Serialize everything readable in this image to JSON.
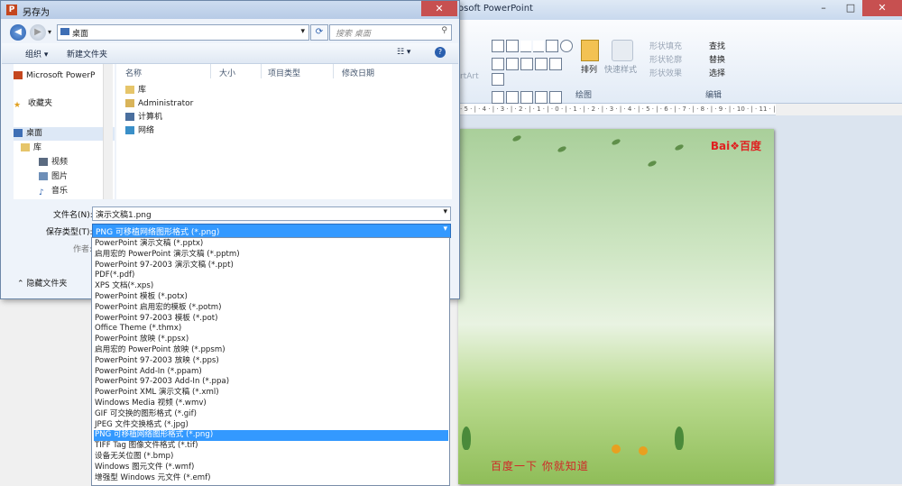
{
  "powerpoint": {
    "title": "osoft PowerPoint",
    "window_controls": [
      "–",
      "□",
      "✕"
    ],
    "ribbon": {
      "arrange_label": "排列",
      "quick_styles_label": "快速样式",
      "shape_fill": "形状填充",
      "shape_outline": "形状轮廓",
      "shape_effects": "形状效果",
      "find": "查找",
      "replace": "替换",
      "select": "选择",
      "group_drawing": "绘图",
      "group_editing": "编辑",
      "art_label": "rtArt"
    },
    "ruler_text": "· 5 · | · 4 · | · 3 · | · 2 · | · 1 · | · 0 · | · 1 · | · 2 · | · 3 · | · 4 · | · 5 · | · 6 · | · 7 · | · 8 · | · 9 · | · 10 · | · 11 · | · 12 ·",
    "slide": {
      "logo": "Bai❖百度",
      "caption": "百度一下  你就知道"
    }
  },
  "dialog": {
    "title": "另存为",
    "app_icon": "P",
    "address": "桌面",
    "search_placeholder": "搜索 桌面",
    "toolbar": {
      "organize": "组织 ▾",
      "new_folder": "新建文件夹"
    },
    "nav": [
      {
        "label": "Microsoft PowerP",
        "icon": "powerpoint-icon"
      },
      {
        "label": "收藏夹",
        "icon": "star-icon"
      },
      {
        "label": "桌面",
        "icon": "desktop-icon"
      },
      {
        "label": "库",
        "icon": "library-icon"
      },
      {
        "label": "视频",
        "icon": "video-icon"
      },
      {
        "label": "图片",
        "icon": "picture-icon"
      },
      {
        "label": "音乐",
        "icon": "music-icon"
      }
    ],
    "columns": [
      "名称",
      "大小",
      "项目类型",
      "修改日期"
    ],
    "files": [
      {
        "name": "库",
        "icon": "library-icon"
      },
      {
        "name": "Administrator",
        "icon": "user-folder-icon"
      },
      {
        "name": "计算机",
        "icon": "computer-icon"
      },
      {
        "name": "网络",
        "icon": "network-icon"
      }
    ],
    "filename_label": "文件名(N):",
    "filename_value": "演示文稿1.png",
    "savetype_label": "保存类型(T):",
    "savetype_value": "PNG 可移植网络图形格式 (*.png)",
    "author_label": "作者:",
    "hide_folders": "隐藏文件夹",
    "options": [
      "PowerPoint 演示文稿 (*.pptx)",
      "启用宏的 PowerPoint 演示文稿 (*.pptm)",
      "PowerPoint 97-2003 演示文稿 (*.ppt)",
      "PDF(*.pdf)",
      "XPS 文档(*.xps)",
      "PowerPoint 模板 (*.potx)",
      "PowerPoint 启用宏的模板 (*.potm)",
      "PowerPoint 97-2003 模板 (*.pot)",
      "Office Theme (*.thmx)",
      "PowerPoint 放映 (*.ppsx)",
      "启用宏的 PowerPoint 放映 (*.ppsm)",
      "PowerPoint 97-2003 放映 (*.pps)",
      "PowerPoint Add-In (*.ppam)",
      "PowerPoint 97-2003 Add-In (*.ppa)",
      "PowerPoint XML 演示文稿 (*.xml)",
      "Windows Media 视频 (*.wmv)",
      "GIF 可交换的图形格式 (*.gif)",
      "JPEG 文件交换格式 (*.jpg)",
      "PNG 可移植网络图形格式 (*.png)",
      "TIFF Tag 图像文件格式 (*.tif)",
      "设备无关位图 (*.bmp)",
      "Windows 图元文件 (*.wmf)",
      "增强型 Windows 元文件 (*.emf)"
    ],
    "selected_option_index": 18,
    "colors": {
      "selection": "#3399ff",
      "close": "#c75050"
    }
  }
}
